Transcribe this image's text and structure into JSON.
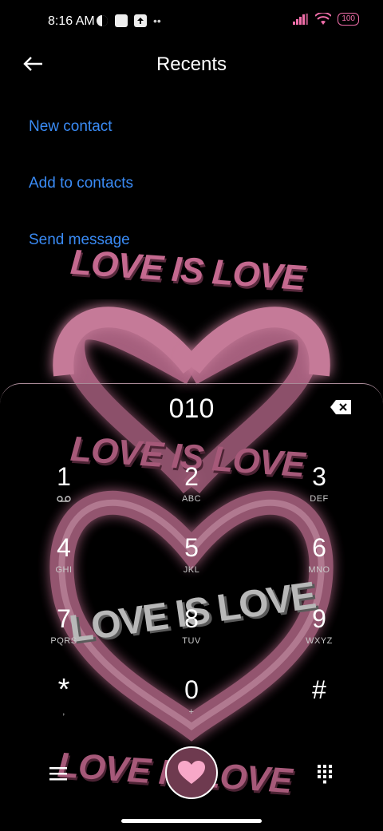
{
  "status_bar": {
    "time": "8:16 AM",
    "battery": "100"
  },
  "header": {
    "title": "Recents"
  },
  "actions": {
    "new_contact": "New contact",
    "add_to_contacts": "Add to contacts",
    "send_message": "Send message"
  },
  "dialer": {
    "number": "010",
    "keys": [
      {
        "digit": "1",
        "letters": ""
      },
      {
        "digit": "2",
        "letters": "ABC"
      },
      {
        "digit": "3",
        "letters": "DEF"
      },
      {
        "digit": "4",
        "letters": "GHI"
      },
      {
        "digit": "5",
        "letters": "JKL"
      },
      {
        "digit": "6",
        "letters": "MNO"
      },
      {
        "digit": "7",
        "letters": "PQRS"
      },
      {
        "digit": "8",
        "letters": "TUV"
      },
      {
        "digit": "9",
        "letters": "WXYZ"
      },
      {
        "digit": "*",
        "letters": ","
      },
      {
        "digit": "0",
        "letters": "+"
      },
      {
        "digit": "#",
        "letters": ""
      }
    ]
  },
  "wallpaper": {
    "text": "LOVE IS LOVE",
    "accent": "#e06a9c",
    "glow": "#f5a3c7"
  },
  "colors": {
    "link": "#3a8bf5",
    "battery": "#f06ea9",
    "call_button": "#6e3a4f"
  },
  "icons": {
    "back": "arrow-left-icon",
    "backspace": "backspace-icon",
    "menu": "menu-icon",
    "call": "heart-icon",
    "keypad": "keypad-icon",
    "voicemail": "voicemail-icon"
  }
}
